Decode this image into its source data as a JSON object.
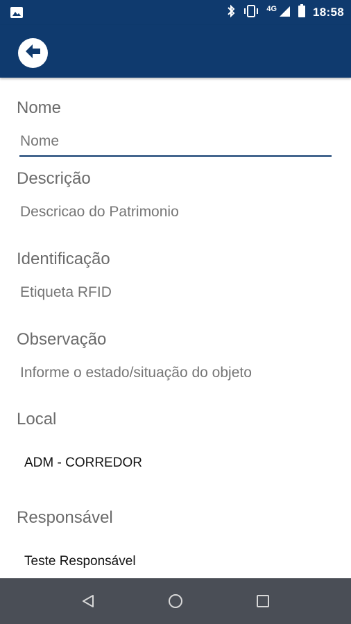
{
  "status_bar": {
    "network": "4G",
    "time": "18:58",
    "icons": [
      "image-icon",
      "bluetooth-icon",
      "vibrate-icon",
      "signal-icon",
      "battery-icon"
    ]
  },
  "app_bar": {
    "back_icon": "arrow-left-icon",
    "color": "#0f3a6e"
  },
  "form": {
    "nome": {
      "label": "Nome",
      "placeholder": "Nome",
      "value": ""
    },
    "descricao": {
      "label": "Descrição",
      "placeholder": "Descricao do Patrimonio",
      "value": ""
    },
    "identificacao": {
      "label": "Identificação",
      "placeholder": "Etiqueta RFID",
      "value": ""
    },
    "observacao": {
      "label": "Observação",
      "placeholder": "Informe o estado/situação do objeto",
      "value": ""
    },
    "local": {
      "label": "Local",
      "value": "ADM - CORREDOR"
    },
    "responsavel": {
      "label": "Responsável",
      "value": "Teste Responsável"
    }
  },
  "nav_bar": {
    "icons": [
      "back-triangle-icon",
      "home-circle-icon",
      "recents-square-icon"
    ]
  }
}
